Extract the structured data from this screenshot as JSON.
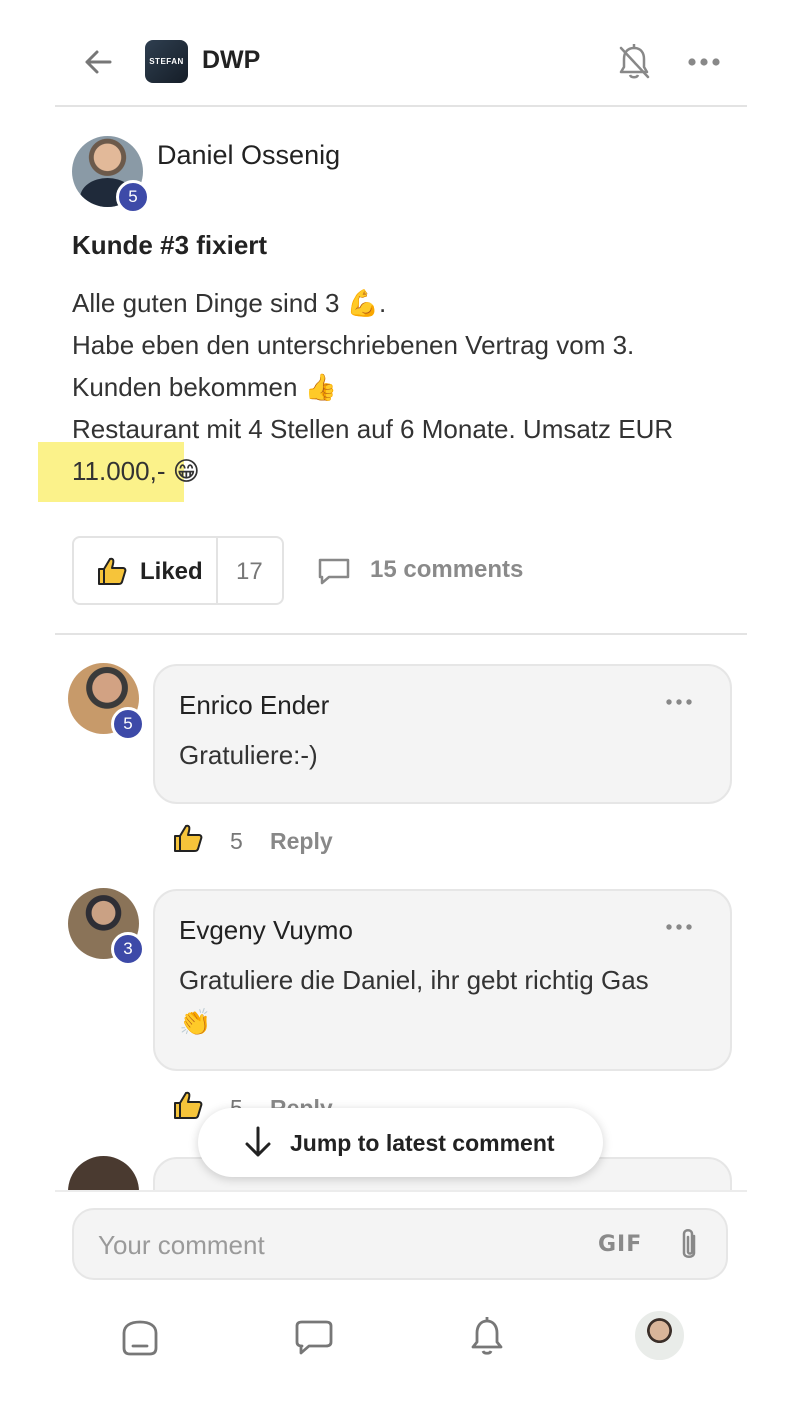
{
  "header": {
    "group_name": "DWP",
    "logo_text": "STEFAN"
  },
  "post": {
    "author": "Daniel Ossenig",
    "author_level": "5",
    "title": "Kunde #3 fixiert",
    "body_lines": [
      "Alle guten Dinge sind 3 💪.",
      "Habe eben den unterschriebenen Vertrag vom 3.",
      "Kunden bekommen 👍",
      "Restaurant mit 4 Stellen auf 6 Monate. Umsatz EUR",
      "11.000,- 😁"
    ],
    "like_label": "Liked",
    "like_count": "17",
    "comments_label": "15 comments"
  },
  "comments": [
    {
      "name": "Enrico Ender",
      "level": "5",
      "text": "Gratuliere:-)",
      "likes": "5",
      "reply_label": "Reply"
    },
    {
      "name": "Evgeny Vuymo",
      "level": "3",
      "text_lines": [
        "Gratuliere die Daniel, ihr gebt richtig Gas",
        "👏"
      ],
      "likes": "5",
      "reply_label": "Reply"
    }
  ],
  "jump": {
    "label": "Jump to latest comment"
  },
  "composer": {
    "placeholder": "Your comment",
    "gif_label": "GIF"
  },
  "colors": {
    "badge": "#3d4aa8",
    "highlight": "#fbf28a",
    "thumb": "#f6c43a"
  },
  "icons": {
    "back": "arrow-left-icon",
    "bell_off": "bell-off-icon",
    "more": "more-horizontal-icon",
    "nav": [
      "home-icon",
      "chat-icon",
      "bell-icon",
      "profile-avatar"
    ]
  }
}
